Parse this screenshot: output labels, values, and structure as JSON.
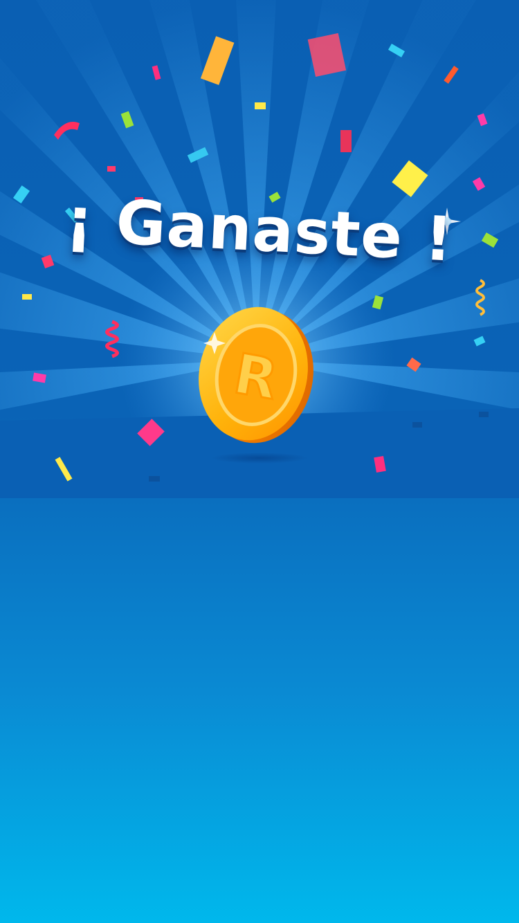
{
  "screen": {
    "title": "¡ Ganaste !",
    "coin_letter": "R",
    "colors": {
      "background_top": "#0a5fb3",
      "background_bottom": "#00b8ec",
      "coin_face": "#ffb20a",
      "coin_rim": "#ff9d00",
      "title_text": "#ffffff"
    },
    "icons": [
      "sparkle-icon",
      "coin-icon",
      "confetti"
    ]
  }
}
